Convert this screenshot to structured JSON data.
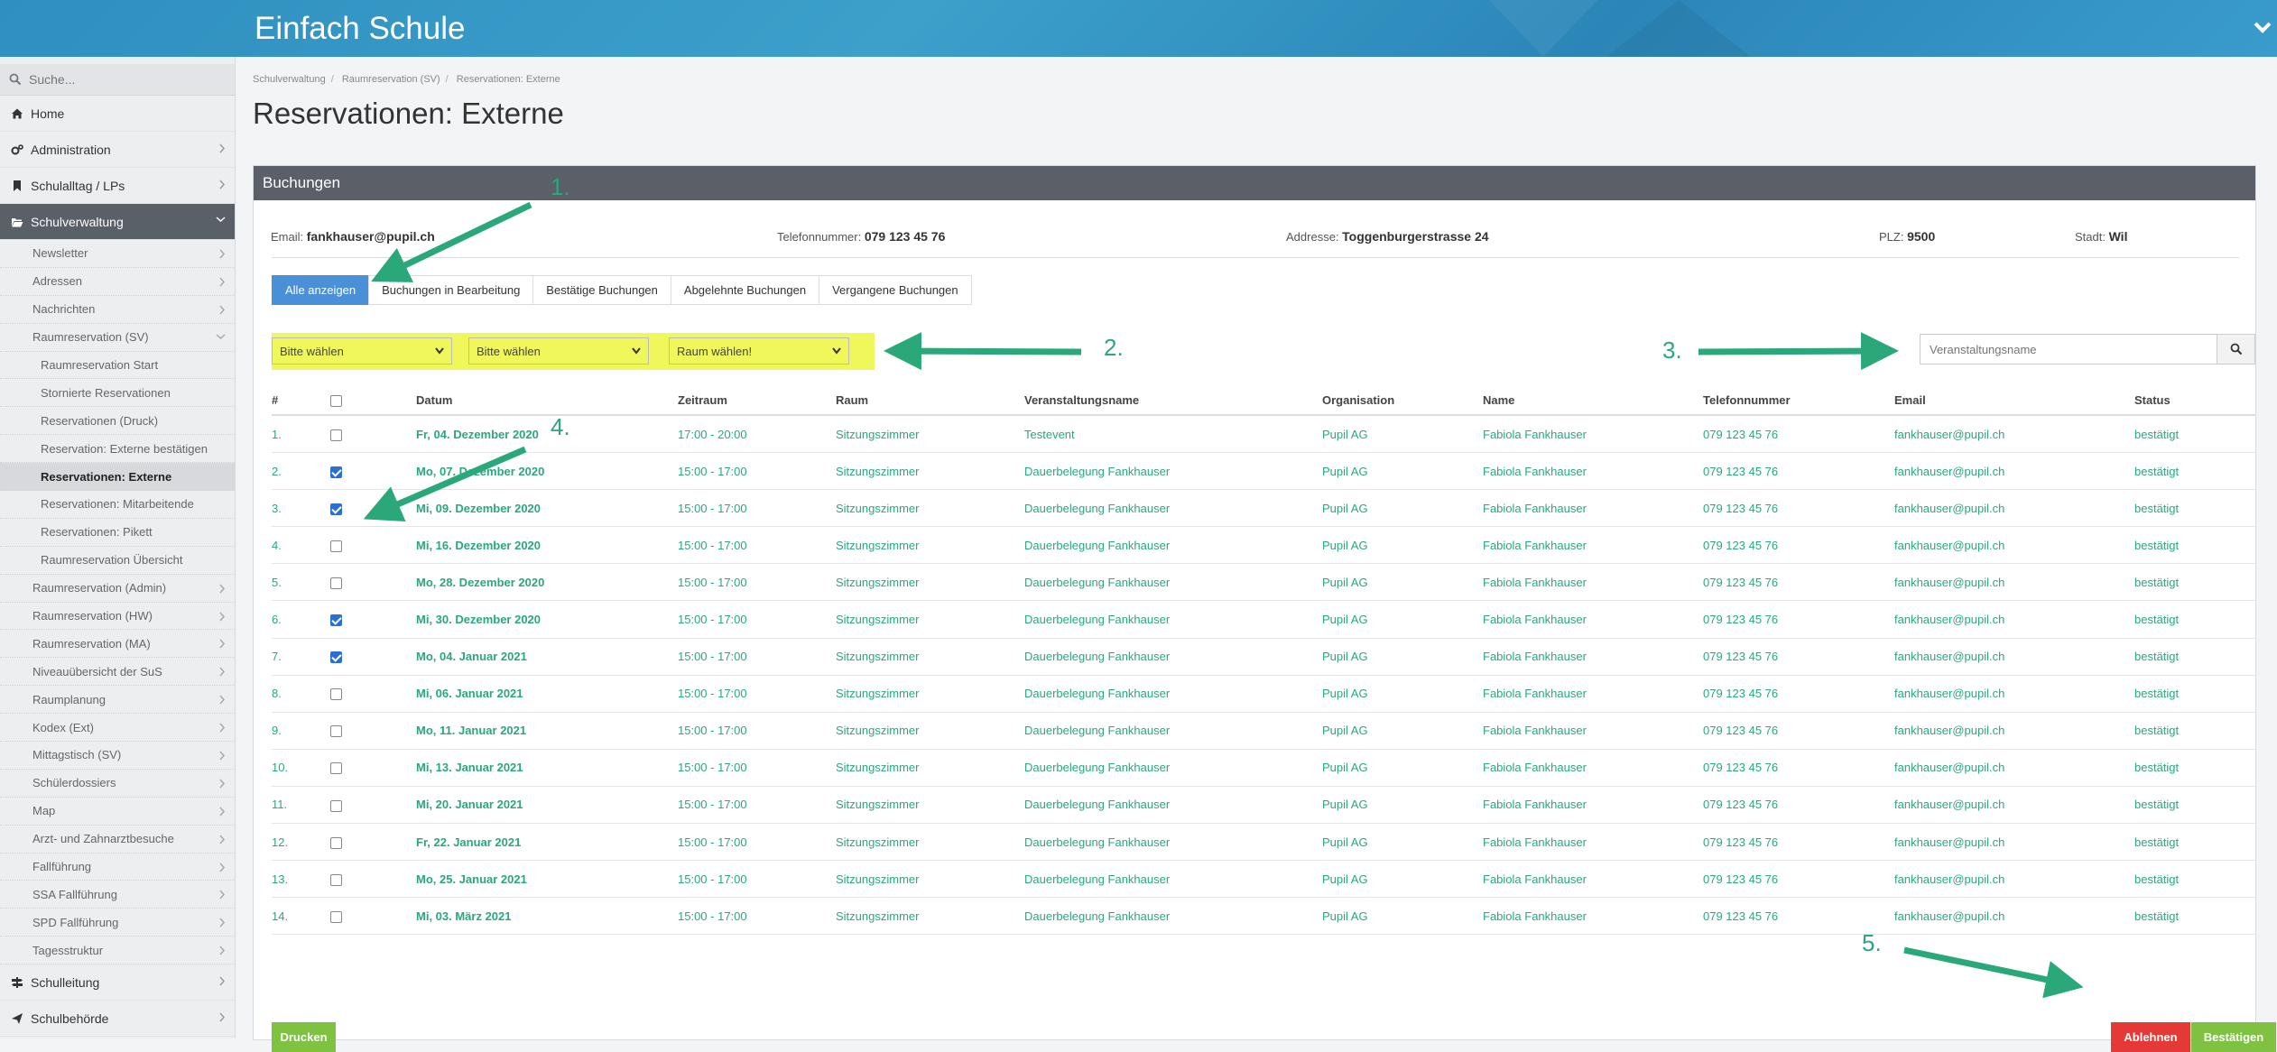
{
  "app": {
    "title": "Einfach Schule"
  },
  "sidebar": {
    "search_placeholder": "Suche...",
    "items": [
      {
        "label": "Home",
        "icon": "home-icon",
        "type": "top"
      },
      {
        "label": "Administration",
        "icon": "cogs-icon",
        "type": "top"
      },
      {
        "label": "Schulalltag / LPs",
        "icon": "bookmark-icon",
        "type": "top"
      },
      {
        "label": "Schulverwaltung",
        "icon": "folder-open-icon",
        "type": "top",
        "active": true
      }
    ],
    "sub_items": [
      {
        "label": "Newsletter",
        "chev": true
      },
      {
        "label": "Adressen",
        "chev": true
      },
      {
        "label": "Nachrichten",
        "chev": true
      },
      {
        "label": "Raumreservation (SV)",
        "chev": true,
        "open": true
      },
      {
        "label": "Raumreservation Start",
        "lvl": 3
      },
      {
        "label": "Stornierte Reservationen",
        "lvl": 3
      },
      {
        "label": "Reservationen (Druck)",
        "lvl": 3
      },
      {
        "label": "Reservation: Externe bestätigen",
        "lvl": 3
      },
      {
        "label": "Reservationen: Externe",
        "lvl": 3,
        "selected": true
      },
      {
        "label": "Reservationen: Mitarbeitende",
        "lvl": 3
      },
      {
        "label": "Reservationen: Pikett",
        "lvl": 3
      },
      {
        "label": "Raumreservation Übersicht",
        "lvl": 3
      },
      {
        "label": "Raumreservation (Admin)",
        "chev": true
      },
      {
        "label": "Raumreservation (HW)",
        "chev": true
      },
      {
        "label": "Raumreservation (MA)",
        "chev": true
      },
      {
        "label": "Niveauübersicht der SuS",
        "chev": true
      },
      {
        "label": "Raumplanung",
        "chev": true
      },
      {
        "label": "Kodex (Ext)",
        "chev": true
      },
      {
        "label": "Mittagstisch (SV)",
        "chev": true
      },
      {
        "label": "Schülerdossiers",
        "chev": true
      },
      {
        "label": "Map",
        "chev": true
      },
      {
        "label": "Arzt- und Zahnarztbesuche",
        "chev": true
      },
      {
        "label": "Fallführung",
        "chev": true
      },
      {
        "label": "SSA Fallführung",
        "chev": true
      },
      {
        "label": "SPD Fallführung",
        "chev": true
      },
      {
        "label": "Tagesstruktur",
        "chev": true
      }
    ],
    "bottom_items": [
      {
        "label": "Schulleitung",
        "icon": "signpost-icon"
      },
      {
        "label": "Schulbehörde",
        "icon": "paper-plane-icon"
      }
    ]
  },
  "breadcrumb": [
    "Schulverwaltung",
    "Raumreservation (SV)",
    "Reservationen: Externe"
  ],
  "page_title": "Reservationen: Externe",
  "panel": {
    "title": "Buchungen",
    "info": {
      "email_label": "Email:",
      "email": "fankhauser@pupil.ch",
      "phone_label": "Telefonnummer:",
      "phone": "079 123 45 76",
      "address_label": "Addresse:",
      "address": "Toggenburgerstrasse 24",
      "plz_label": "PLZ:",
      "plz": "9500",
      "city_label": "Stadt:",
      "city": "Wil"
    },
    "tabs": [
      "Alle anzeigen",
      "Buchungen in Bearbeitung",
      "Bestätige Buchungen",
      "Abgelehnte Buchungen",
      "Vergangene Buchungen"
    ],
    "filters": [
      "Bitte wählen",
      "Bitte wählen",
      "Raum wählen!"
    ],
    "search_placeholder": "Veranstaltungsname",
    "columns": [
      "#",
      "",
      "Datum",
      "Zeitraum",
      "Raum",
      "Veranstaltungsname",
      "Organisation",
      "Name",
      "Telefonnummer",
      "Email",
      "Status"
    ],
    "rows": [
      {
        "n": "1.",
        "checked": false,
        "datum": "Fr, 04. Dezember 2020",
        "zeit": "17:00 - 20:00",
        "raum": "Sitzungszimmer",
        "event": "Testevent",
        "org": "Pupil AG",
        "name": "Fabiola Fankhauser",
        "tel": "079 123 45 76",
        "email": "fankhauser@pupil.ch",
        "status": "bestätigt"
      },
      {
        "n": "2.",
        "checked": true,
        "datum": "Mo, 07. Dezember 2020",
        "zeit": "15:00 - 17:00",
        "raum": "Sitzungszimmer",
        "event": "Dauerbelegung Fankhauser",
        "org": "Pupil AG",
        "name": "Fabiola Fankhauser",
        "tel": "079 123 45 76",
        "email": "fankhauser@pupil.ch",
        "status": "bestätigt"
      },
      {
        "n": "3.",
        "checked": true,
        "datum": "Mi, 09. Dezember 2020",
        "zeit": "15:00 - 17:00",
        "raum": "Sitzungszimmer",
        "event": "Dauerbelegung Fankhauser",
        "org": "Pupil AG",
        "name": "Fabiola Fankhauser",
        "tel": "079 123 45 76",
        "email": "fankhauser@pupil.ch",
        "status": "bestätigt"
      },
      {
        "n": "4.",
        "checked": false,
        "datum": "Mi, 16. Dezember 2020",
        "zeit": "15:00 - 17:00",
        "raum": "Sitzungszimmer",
        "event": "Dauerbelegung Fankhauser",
        "org": "Pupil AG",
        "name": "Fabiola Fankhauser",
        "tel": "079 123 45 76",
        "email": "fankhauser@pupil.ch",
        "status": "bestätigt"
      },
      {
        "n": "5.",
        "checked": false,
        "datum": "Mo, 28. Dezember 2020",
        "zeit": "15:00 - 17:00",
        "raum": "Sitzungszimmer",
        "event": "Dauerbelegung Fankhauser",
        "org": "Pupil AG",
        "name": "Fabiola Fankhauser",
        "tel": "079 123 45 76",
        "email": "fankhauser@pupil.ch",
        "status": "bestätigt"
      },
      {
        "n": "6.",
        "checked": true,
        "datum": "Mi, 30. Dezember 2020",
        "zeit": "15:00 - 17:00",
        "raum": "Sitzungszimmer",
        "event": "Dauerbelegung Fankhauser",
        "org": "Pupil AG",
        "name": "Fabiola Fankhauser",
        "tel": "079 123 45 76",
        "email": "fankhauser@pupil.ch",
        "status": "bestätigt"
      },
      {
        "n": "7.",
        "checked": true,
        "datum": "Mo, 04. Januar 2021",
        "zeit": "15:00 - 17:00",
        "raum": "Sitzungszimmer",
        "event": "Dauerbelegung Fankhauser",
        "org": "Pupil AG",
        "name": "Fabiola Fankhauser",
        "tel": "079 123 45 76",
        "email": "fankhauser@pupil.ch",
        "status": "bestätigt"
      },
      {
        "n": "8.",
        "checked": false,
        "datum": "Mi, 06. Januar 2021",
        "zeit": "15:00 - 17:00",
        "raum": "Sitzungszimmer",
        "event": "Dauerbelegung Fankhauser",
        "org": "Pupil AG",
        "name": "Fabiola Fankhauser",
        "tel": "079 123 45 76",
        "email": "fankhauser@pupil.ch",
        "status": "bestätigt"
      },
      {
        "n": "9.",
        "checked": false,
        "datum": "Mo, 11. Januar 2021",
        "zeit": "15:00 - 17:00",
        "raum": "Sitzungszimmer",
        "event": "Dauerbelegung Fankhauser",
        "org": "Pupil AG",
        "name": "Fabiola Fankhauser",
        "tel": "079 123 45 76",
        "email": "fankhauser@pupil.ch",
        "status": "bestätigt"
      },
      {
        "n": "10.",
        "checked": false,
        "datum": "Mi, 13. Januar 2021",
        "zeit": "15:00 - 17:00",
        "raum": "Sitzungszimmer",
        "event": "Dauerbelegung Fankhauser",
        "org": "Pupil AG",
        "name": "Fabiola Fankhauser",
        "tel": "079 123 45 76",
        "email": "fankhauser@pupil.ch",
        "status": "bestätigt"
      },
      {
        "n": "11.",
        "checked": false,
        "datum": "Mi, 20. Januar 2021",
        "zeit": "15:00 - 17:00",
        "raum": "Sitzungszimmer",
        "event": "Dauerbelegung Fankhauser",
        "org": "Pupil AG",
        "name": "Fabiola Fankhauser",
        "tel": "079 123 45 76",
        "email": "fankhauser@pupil.ch",
        "status": "bestätigt"
      },
      {
        "n": "12.",
        "checked": false,
        "datum": "Fr, 22. Januar 2021",
        "zeit": "15:00 - 17:00",
        "raum": "Sitzungszimmer",
        "event": "Dauerbelegung Fankhauser",
        "org": "Pupil AG",
        "name": "Fabiola Fankhauser",
        "tel": "079 123 45 76",
        "email": "fankhauser@pupil.ch",
        "status": "bestätigt"
      },
      {
        "n": "13.",
        "checked": false,
        "datum": "Mo, 25. Januar 2021",
        "zeit": "15:00 - 17:00",
        "raum": "Sitzungszimmer",
        "event": "Dauerbelegung Fankhauser",
        "org": "Pupil AG",
        "name": "Fabiola Fankhauser",
        "tel": "079 123 45 76",
        "email": "fankhauser@pupil.ch",
        "status": "bestätigt"
      },
      {
        "n": "14.",
        "checked": false,
        "datum": "Mi, 03. März 2021",
        "zeit": "15:00 - 17:00",
        "raum": "Sitzungszimmer",
        "event": "Dauerbelegung Fankhauser",
        "org": "Pupil AG",
        "name": "Fabiola Fankhauser",
        "tel": "079 123 45 76",
        "email": "fankhauser@pupil.ch",
        "status": "bestätigt"
      }
    ],
    "buttons": {
      "print": "Drucken",
      "reject": "Ablehnen",
      "confirm": "Bestätigen"
    }
  },
  "annotations": [
    "1.",
    "2.",
    "3.",
    "4.",
    "5."
  ],
  "colors": {
    "accent": "#2aa87a",
    "header": "#3a9ccb",
    "tab_active": "#4a90d9",
    "highlight": "#f0f75a",
    "reject": "#e53935",
    "confirm": "#7fc241"
  }
}
